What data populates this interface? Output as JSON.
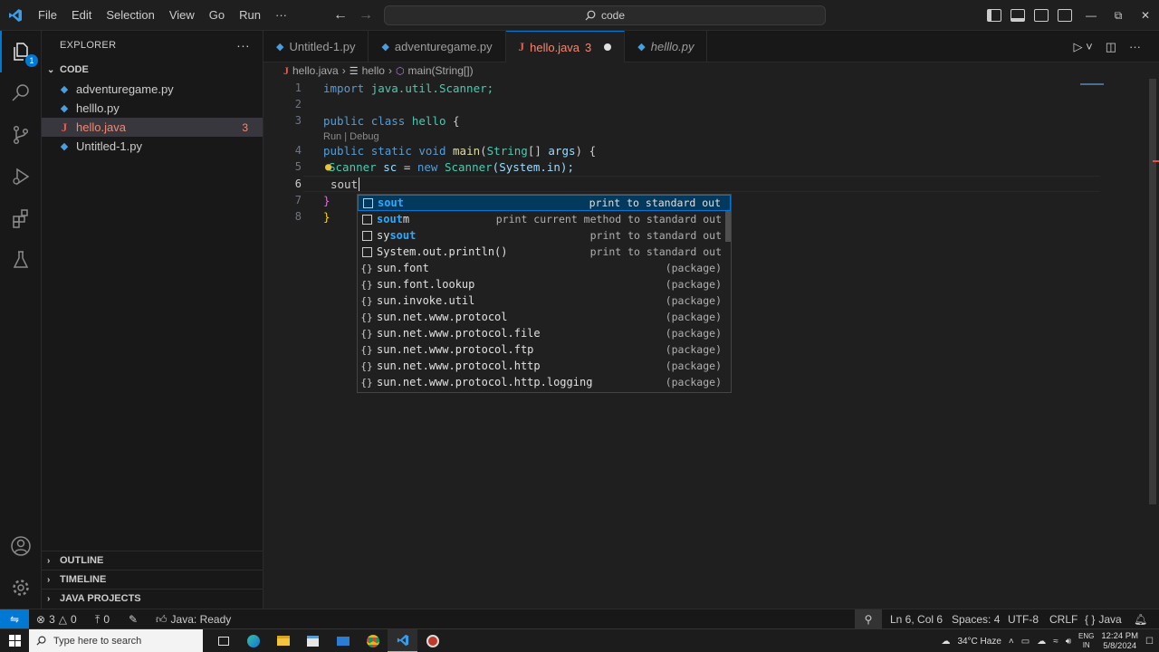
{
  "window": {
    "menu": [
      "File",
      "Edit",
      "Selection",
      "View",
      "Go",
      "Run",
      "···"
    ],
    "search_text": "code",
    "accent": "#0078d4"
  },
  "activity_bar": {
    "explorer_badge": "1"
  },
  "sidebar": {
    "title": "EXPLORER",
    "more": "···",
    "folder": "CODE",
    "files": [
      {
        "name": "adventuregame.py",
        "icon": "python-icon"
      },
      {
        "name": "helllo.py",
        "icon": "python-icon"
      },
      {
        "name": "hello.java",
        "icon": "java-icon",
        "count": "3"
      },
      {
        "name": "Untitled-1.py",
        "icon": "python-icon"
      }
    ],
    "sections": [
      "OUTLINE",
      "TIMELINE",
      "JAVA PROJECTS"
    ]
  },
  "tabs": [
    {
      "label": "Untitled-1.py"
    },
    {
      "label": "adventuregame.py"
    },
    {
      "label": "hello.java",
      "count": "3"
    },
    {
      "label": "helllo.py"
    }
  ],
  "breadcrumb": {
    "file": "hello.java",
    "class": "hello",
    "method": "main(String[])"
  },
  "editor": {
    "line_numbers": [
      "1",
      "2",
      "3",
      "4",
      "5",
      "6",
      "7",
      "8"
    ],
    "codelens": "Run | Debug",
    "lines": {
      "l1": {
        "kw": "import",
        "rest": "java.util.Scanner;"
      },
      "l3": {
        "kw1": "public",
        "kw2": "class",
        "name": "hello",
        "brace": "{"
      },
      "l4": {
        "kw1": "public",
        "kw2": "static",
        "kw3": "void",
        "fn": "main",
        "open": "(",
        "type": "String",
        "arr": "[]",
        "param": "args",
        "close": ") {"
      },
      "l5": {
        "type": "Scanner",
        "var": "sc",
        "eq": "=",
        "kw": "new",
        "ctor": "Scanner",
        "args": "(System.in);"
      },
      "l6": "sout",
      "l7": "}",
      "l8": "}"
    }
  },
  "suggestions": [
    {
      "match": "sout",
      "rest": "",
      "detail": "print to standard out",
      "kind": "snippet"
    },
    {
      "match": "sout",
      "rest": "m",
      "detail": "print current method to standard out",
      "kind": "snippet"
    },
    {
      "pre": "sy",
      "match": "sout",
      "rest": "",
      "detail": "print to standard out",
      "kind": "snippet"
    },
    {
      "label": "System.out.println()",
      "detail": "print to standard out",
      "kind": "snippet"
    },
    {
      "label": "sun.font",
      "detail": "(package)",
      "kind": "package"
    },
    {
      "label": "sun.font.lookup",
      "detail": "(package)",
      "kind": "package"
    },
    {
      "label": "sun.invoke.util",
      "detail": "(package)",
      "kind": "package"
    },
    {
      "label": "sun.net.www.protocol",
      "detail": "(package)",
      "kind": "package"
    },
    {
      "label": "sun.net.www.protocol.file",
      "detail": "(package)",
      "kind": "package"
    },
    {
      "label": "sun.net.www.protocol.ftp",
      "detail": "(package)",
      "kind": "package"
    },
    {
      "label": "sun.net.www.protocol.http",
      "detail": "(package)",
      "kind": "package"
    },
    {
      "label": "sun.net.www.protocol.http.logging",
      "detail": "(package)",
      "kind": "package"
    }
  ],
  "status": {
    "errors": "3",
    "warnings": "0",
    "ports": "0",
    "java_status": "Java: Ready",
    "position": "Ln 6, Col 6",
    "spaces": "Spaces: 4",
    "encoding": "UTF-8",
    "eol": "CRLF",
    "language": "Java",
    "language_braces": "{ }"
  },
  "taskbar": {
    "search_placeholder": "Type here to search",
    "weather": "34°C Haze",
    "lang_top": "ENG",
    "lang_bottom": "IN",
    "time": "12:24 PM",
    "date": "5/8/2024"
  }
}
